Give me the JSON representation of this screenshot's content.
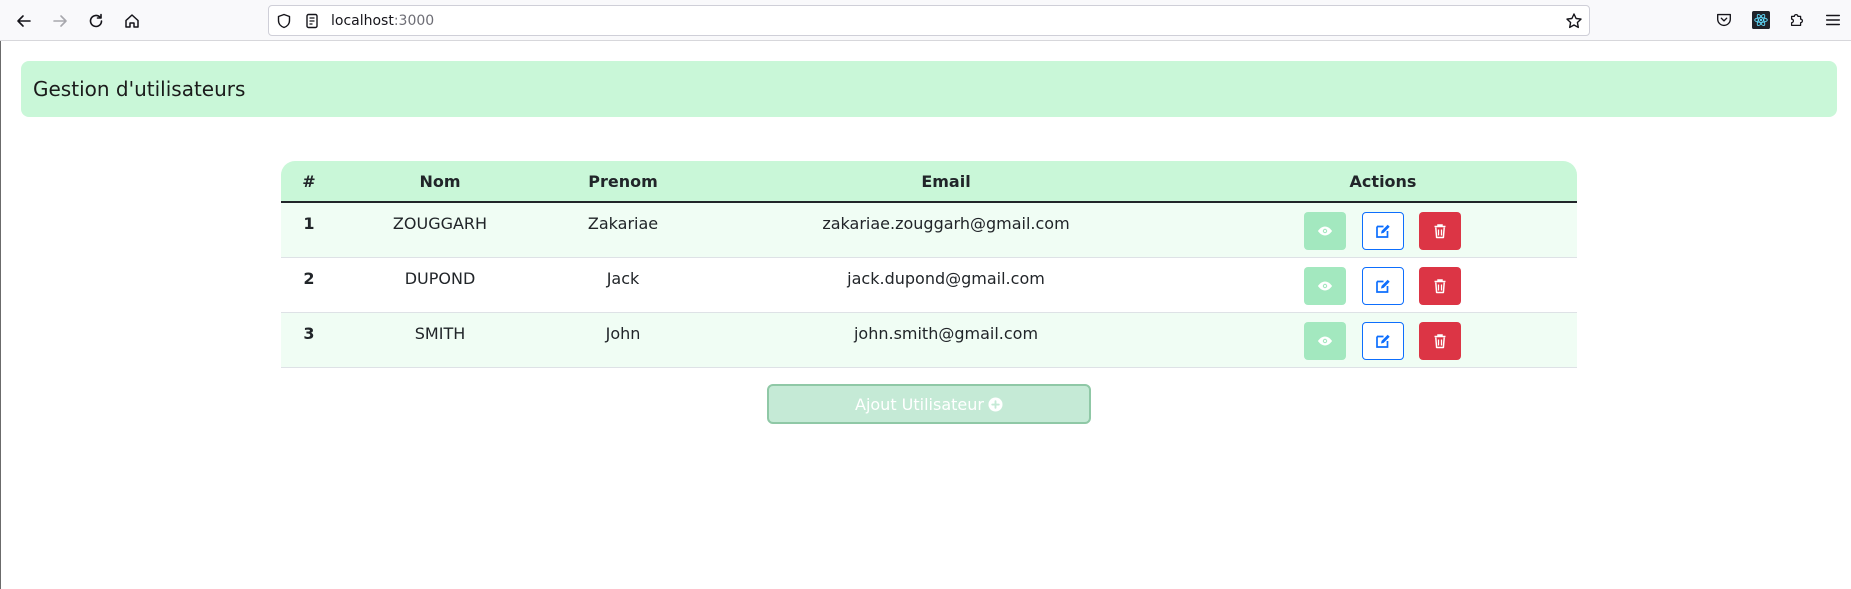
{
  "browser": {
    "url_host": "localhost",
    "url_port": ":3000"
  },
  "page": {
    "title": "Gestion d'utilisateurs",
    "columns": [
      "#",
      "Nom",
      "Prenom",
      "Email",
      "Actions"
    ],
    "rows": [
      {
        "num": "1",
        "nom": "ZOUGGARH",
        "prenom": "Zakariae",
        "email": "zakariae.zouggarh@gmail.com"
      },
      {
        "num": "2",
        "nom": "DUPOND",
        "prenom": "Jack",
        "email": "jack.dupond@gmail.com"
      },
      {
        "num": "3",
        "nom": "SMITH",
        "prenom": "John",
        "email": "john.smith@gmail.com"
      }
    ],
    "actions": {
      "view_icon": "eye-icon",
      "edit_icon": "edit-icon",
      "delete_icon": "trash-icon"
    },
    "add_button_label": "Ajout Utilisateur"
  },
  "colors": {
    "header_bg": "#c9f7d8",
    "view_btn": "#a3e8bf",
    "edit_btn_border": "#0d6efd",
    "delete_btn": "#dc3545",
    "add_btn_bg": "#c5ead6"
  }
}
